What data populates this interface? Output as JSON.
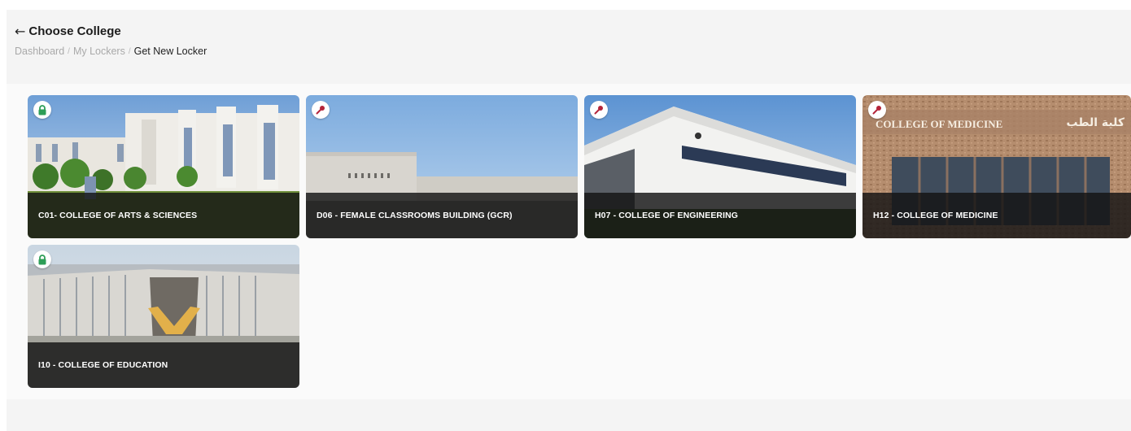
{
  "header": {
    "back_icon": "arrow-left-icon",
    "title": "Choose College"
  },
  "breadcrumb": {
    "items": [
      "Dashboard",
      "My Lockers",
      "Get New Locker"
    ],
    "separator": "/"
  },
  "colors": {
    "available": "#2e9e57",
    "key": "#b4243a"
  },
  "colleges": [
    {
      "name": "C01- COLLEGE OF ARTS & SCIENCES",
      "status_icon": "lock-icon"
    },
    {
      "name": "D06 - FEMALE CLASSROOMS BUILDING (GCR)",
      "status_icon": "key-icon"
    },
    {
      "name": "H07 - COLLEGE OF ENGINEERING",
      "status_icon": "key-icon"
    },
    {
      "name": "H12 - COLLEGE OF MEDICINE",
      "status_icon": "key-icon"
    },
    {
      "name": "I10 - COLLEGE OF EDUCATION",
      "status_icon": "lock-icon"
    }
  ],
  "photo_signage": {
    "medicine_en": "COLLEGE OF MEDICINE",
    "medicine_ar": "كلية الطب"
  }
}
